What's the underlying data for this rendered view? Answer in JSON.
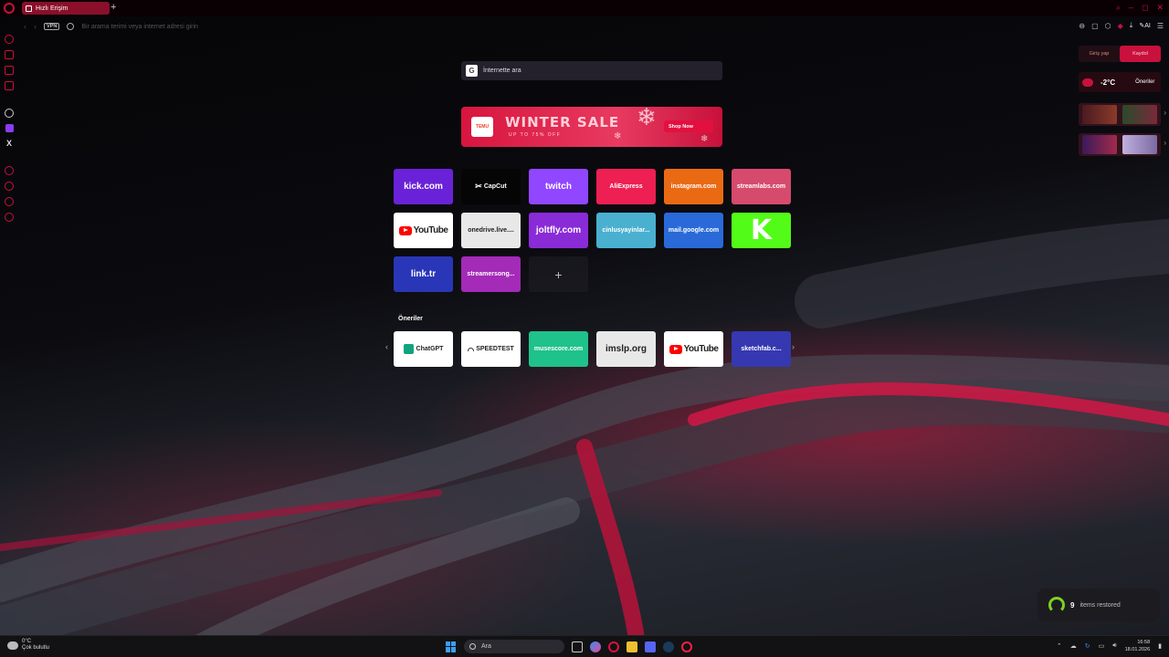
{
  "tab": {
    "title": "Hızlı Erişim",
    "new_tab": "+"
  },
  "address_bar": {
    "vpn": "VPN",
    "placeholder": "Bir arama terimi veya internet adresi girin",
    "ai_label": "AI"
  },
  "search": {
    "engine_icon": "G",
    "placeholder": "İnternette ara"
  },
  "banner": {
    "brand": "TEMU",
    "title": "WINTER SALE",
    "subtitle": "UP TO 75% OFF",
    "cta": "Shop Now"
  },
  "speed_dials": [
    {
      "label": "kick.com",
      "bg": "#6a22d8",
      "kind": "text",
      "size": "big"
    },
    {
      "label": "CapCut",
      "bg": "#050505",
      "kind": "capcut"
    },
    {
      "label": "twitch",
      "bg": "#9146ff",
      "kind": "text",
      "size": "big"
    },
    {
      "label": "AliExpress",
      "bg": "#ee1f53",
      "kind": "text"
    },
    {
      "label": "instagram.com",
      "bg": "#ea6a14",
      "kind": "text"
    },
    {
      "label": "streamlabs.com",
      "bg": "#d64a6e",
      "kind": "text"
    },
    {
      "label": "YouTube",
      "bg": "#ffffff",
      "kind": "youtube"
    },
    {
      "label": "onedrive.live....",
      "bg": "#e8e8e8",
      "kind": "dark"
    },
    {
      "label": "joltfly.com",
      "bg": "#8a2bd8",
      "kind": "text",
      "size": "big"
    },
    {
      "label": "cinlusyayinlar...",
      "bg": "#4ab0d0",
      "kind": "text"
    },
    {
      "label": "mail.google.com",
      "bg": "#2a6ad8",
      "kind": "text"
    },
    {
      "label": "K",
      "bg": "#53fc18",
      "kind": "kick"
    },
    {
      "label": "link.tr",
      "bg": "#2a36b8",
      "kind": "text",
      "size": "big"
    },
    {
      "label": "streamersong...",
      "bg": "#a42ab8",
      "kind": "text"
    },
    {
      "label": "+",
      "bg": "",
      "kind": "add"
    }
  ],
  "suggestions_title": "Öneriler",
  "suggestions": [
    {
      "label": "ChatGPT",
      "bg": "#ffffff",
      "kind": "chatgpt"
    },
    {
      "label": "SPEEDTEST",
      "bg": "#ffffff",
      "kind": "speedtest"
    },
    {
      "label": "musescore.com",
      "bg": "#1fc28a",
      "kind": "text"
    },
    {
      "label": "imslp.org",
      "bg": "#e8e8e8",
      "kind": "dark-big"
    },
    {
      "label": "YouTube",
      "bg": "#ffffff",
      "kind": "youtube"
    },
    {
      "label": "sketchfab.c...",
      "bg": "#3538b0",
      "kind": "text"
    }
  ],
  "right_panel": {
    "login": "Giriş yap",
    "register": "Kaydol",
    "temperature": "-2°C",
    "oneriler": "Öneriler"
  },
  "toast": {
    "count": "9",
    "text": "items restored"
  },
  "taskbar": {
    "weather_temp": "0°C",
    "weather_desc": "Çok bulutlu",
    "search_placeholder": "Ara",
    "time": "16:58",
    "date": "18.01.2026"
  },
  "colors": {
    "accent": "#c8113c",
    "tab_bg": "#8a0f2a"
  }
}
